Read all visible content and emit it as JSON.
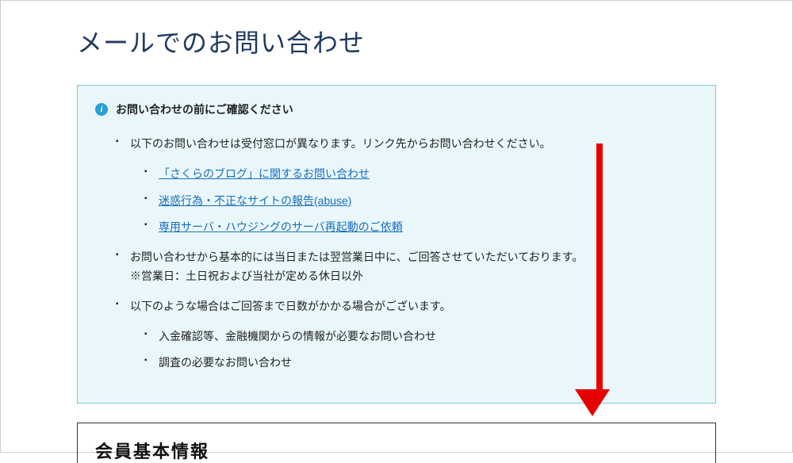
{
  "page": {
    "title": "メールでのお問い合わせ"
  },
  "infobox": {
    "title": "お問い合わせの前にご確認ください",
    "bullet1_text": "以下のお問い合わせは受付窓口が異なります。リンク先からお問い合わせください。",
    "links": [
      "「さくらのブログ」に関するお問い合わせ",
      "迷惑行為・不正なサイトの報告(abuse)",
      "専用サーバ・ハウジングのサーバ再起動のご依頼"
    ],
    "bullet2_line1": "お問い合わせから基本的には当日または翌営業日中に、ご回答させていただいております。",
    "bullet2_line2": "※営業日：土日祝および当社が定める休日以外",
    "bullet3_text": "以下のような場合はご回答まで日数がかかる場合がございます。",
    "bullet3_sub": [
      "入金確認等、金融機関からの情報が必要なお問い合わせ",
      "調査の必要なお問い合わせ"
    ]
  },
  "section": {
    "title": "会員基本情報"
  }
}
